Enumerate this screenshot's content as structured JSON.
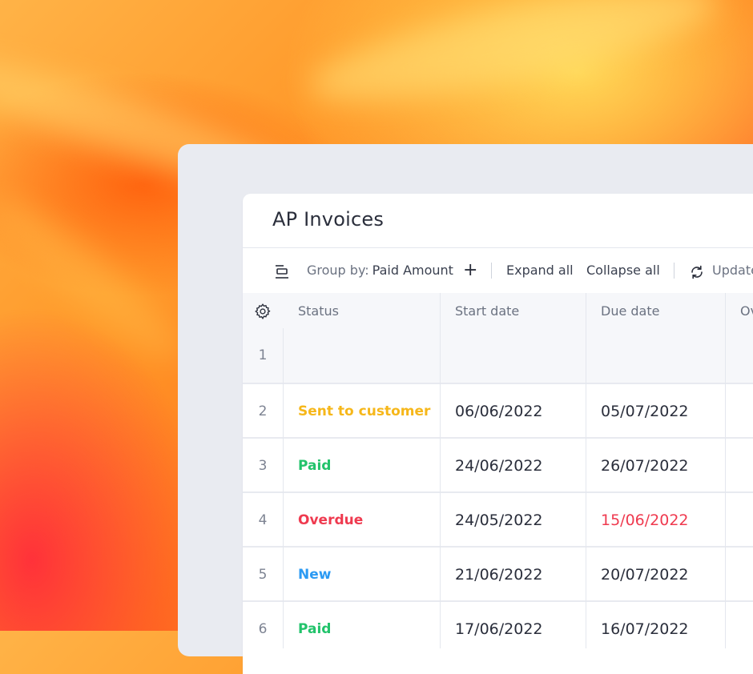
{
  "window": {
    "title": "AP Invoices"
  },
  "toolbar": {
    "group_prefix": "Group by:",
    "group_value": "Paid Amount",
    "add_symbol": "+",
    "expand_label": "Expand all",
    "collapse_label": "Collapse all",
    "update_label": "Update"
  },
  "table": {
    "columns": [
      "Status",
      "Start date",
      "Due date",
      "Ov"
    ],
    "rows": [
      {
        "num": "1",
        "status": "",
        "start": "",
        "due": ""
      },
      {
        "num": "2",
        "status": "Sent to customer",
        "start": "06/06/2022",
        "due": "05/07/2022"
      },
      {
        "num": "3",
        "status": "Paid",
        "start": "24/06/2022",
        "due": "26/07/2022"
      },
      {
        "num": "4",
        "status": "Overdue",
        "start": "24/05/2022",
        "due": "15/06/2022"
      },
      {
        "num": "5",
        "status": "New",
        "start": "21/06/2022",
        "due": "20/07/2022"
      },
      {
        "num": "6",
        "status": "Paid",
        "start": "17/06/2022",
        "due": "16/07/2022"
      }
    ]
  },
  "colors": {
    "sent": "#f6b71a",
    "paid": "#22c36b",
    "overdue": "#ef3a4f",
    "new": "#2b9af3"
  },
  "icons": [
    "group-by-icon",
    "plus-icon",
    "refresh-icon",
    "settings-gear-icon"
  ]
}
